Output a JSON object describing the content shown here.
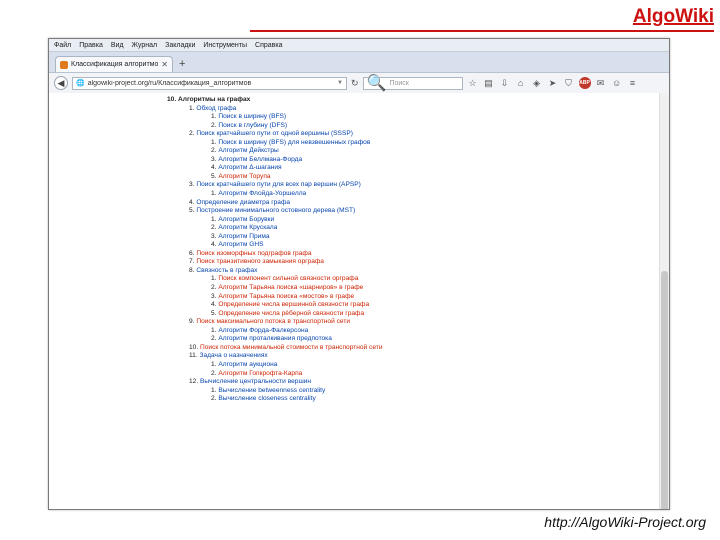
{
  "brand": "AlgoWiki",
  "footer_url": "http://AlgoWiki-Project.org",
  "browser": {
    "menu": [
      "Файл",
      "Правка",
      "Вид",
      "Журнал",
      "Закладки",
      "Инструменты",
      "Справка"
    ],
    "tab_title": "Классификация алгоритмов",
    "new_tab_symbol": "+",
    "url": "algowiki-project.org/ru/Классификация_алгоритмов",
    "search_placeholder": "Поиск",
    "colors": {
      "link": "#0645ad",
      "missing_link": "#cc2200",
      "brand": "#cc1111"
    }
  },
  "toc": [
    {
      "level": 0,
      "num": "10.",
      "text": "Алгоритмы на графах",
      "link": "heading"
    },
    {
      "level": 1,
      "num": "1.",
      "text": "Обход графа",
      "link": "blue"
    },
    {
      "level": 2,
      "num": "1.",
      "text": "Поиск в ширину (BFS)",
      "link": "blue"
    },
    {
      "level": 2,
      "num": "2.",
      "text": "Поиск в глубину (DFS)",
      "link": "blue"
    },
    {
      "level": 1,
      "num": "2.",
      "text": "Поиск кратчайшего пути от одной вершины (SSSP)",
      "link": "blue"
    },
    {
      "level": 2,
      "num": "1.",
      "text": "Поиск в ширину (BFS) для невзвешенных графов",
      "link": "blue"
    },
    {
      "level": 2,
      "num": "2.",
      "text": "Алгоритм Дейкстры",
      "link": "blue"
    },
    {
      "level": 2,
      "num": "3.",
      "text": "Алгоритм Беллмана-Форда",
      "link": "blue"
    },
    {
      "level": 2,
      "num": "4.",
      "text": "Алгоритм Δ-шагания",
      "link": "blue"
    },
    {
      "level": 2,
      "num": "5.",
      "text": "Алгоритм Торупа",
      "link": "red"
    },
    {
      "level": 1,
      "num": "3.",
      "text": "Поиск кратчайшего пути для всех пар вершин (APSP)",
      "link": "blue"
    },
    {
      "level": 2,
      "num": "1.",
      "text": "Алгоритм Флойда-Уоршелла",
      "link": "blue"
    },
    {
      "level": 1,
      "num": "4.",
      "text": "Определение диаметра графа",
      "link": "blue"
    },
    {
      "level": 1,
      "num": "5.",
      "text": "Построение минимального остовного дерева (MST)",
      "link": "blue"
    },
    {
      "level": 2,
      "num": "1.",
      "text": "Алгоритм Борувки",
      "link": "blue"
    },
    {
      "level": 2,
      "num": "2.",
      "text": "Алгоритм Крускала",
      "link": "blue"
    },
    {
      "level": 2,
      "num": "3.",
      "text": "Алгоритм Прима",
      "link": "blue"
    },
    {
      "level": 2,
      "num": "4.",
      "text": "Алгоритм GHS",
      "link": "blue"
    },
    {
      "level": 1,
      "num": "6.",
      "text": "Поиск изоморфных подграфов графа",
      "link": "red"
    },
    {
      "level": 1,
      "num": "7.",
      "text": "Поиск транзитивного замыкания орграфа",
      "link": "red"
    },
    {
      "level": 1,
      "num": "8.",
      "text": "Связность в графах",
      "link": "blue"
    },
    {
      "level": 2,
      "num": "1.",
      "text": "Поиск компонент сильной связности орграфа",
      "link": "red"
    },
    {
      "level": 2,
      "num": "2.",
      "text": "Алгоритм Тарьяна поиска «шарниров» в графе",
      "link": "red"
    },
    {
      "level": 2,
      "num": "3.",
      "text": "Алгоритм Тарьяна поиска «мостов» в графе",
      "link": "red"
    },
    {
      "level": 2,
      "num": "4.",
      "text": "Определение числа вершинной связности графа",
      "link": "red"
    },
    {
      "level": 2,
      "num": "5.",
      "text": "Определение числа рёберной связности графа",
      "link": "red"
    },
    {
      "level": 1,
      "num": "9.",
      "text": "Поиск максимального потока в транспортной сети",
      "link": "red"
    },
    {
      "level": 2,
      "num": "1.",
      "text": "Алгоритм Форда-Фалкерсона",
      "link": "blue"
    },
    {
      "level": 2,
      "num": "2.",
      "text": "Алгоритм проталкивания предпотока",
      "link": "blue"
    },
    {
      "level": 1,
      "num": "10.",
      "text": "Поиск потока минимальной стоимости в транспортной сети",
      "link": "red"
    },
    {
      "level": 1,
      "num": "11.",
      "text": "Задача о назначениях",
      "link": "blue"
    },
    {
      "level": 2,
      "num": "1.",
      "text": "Алгоритм аукциона",
      "link": "blue"
    },
    {
      "level": 2,
      "num": "2.",
      "text": "Алгоритм Гопкрофта-Карпа",
      "link": "red"
    },
    {
      "level": 1,
      "num": "12.",
      "text": "Вычисление центральности вершин",
      "link": "blue"
    },
    {
      "level": 2,
      "num": "1.",
      "text": "Вычисление betweenness centrality",
      "link": "blue"
    },
    {
      "level": 2,
      "num": "2.",
      "text": "Вычисление closeness centrality",
      "link": "blue"
    }
  ]
}
